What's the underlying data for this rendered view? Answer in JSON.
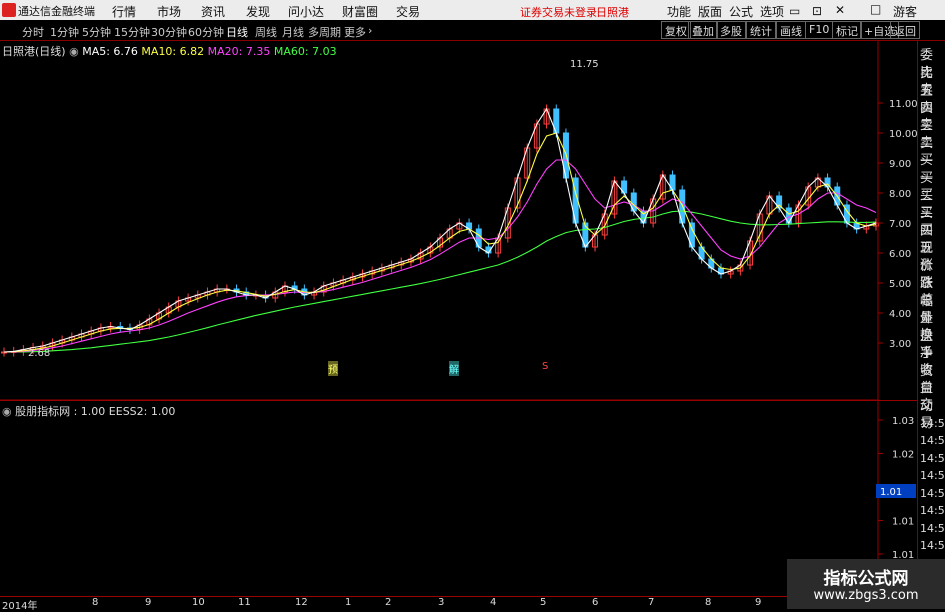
{
  "app": {
    "title": "通达信金融终端",
    "menu": [
      "行情",
      "市场",
      "资讯",
      "发现",
      "问小达",
      "财富圈",
      "交易"
    ],
    "notice": "证券交易未登录",
    "stock": "日照港",
    "right_menu": [
      "功能",
      "版面",
      "公式",
      "选项"
    ],
    "user": "游客"
  },
  "toolbar": {
    "periods": [
      "分时",
      "1分钟",
      "5分钟",
      "15分钟",
      "30分钟",
      "60分钟",
      "日线",
      "周线",
      "月线",
      "多周期",
      "更多"
    ],
    "active": "日线",
    "buttons": [
      "复权",
      "叠加",
      "多股",
      "统计",
      "画线",
      "F10",
      "标记",
      "+自选",
      "返回"
    ]
  },
  "chart": {
    "name": "日照港(日线)",
    "ma5": "MA5: 6.76",
    "ma10": "MA10: 6.82",
    "ma20": "MA20: 7.35",
    "ma60": "MA60: 7.03",
    "high_label": "11.75",
    "low_label": "2.68",
    "markers": [
      "预",
      "解",
      "S"
    ]
  },
  "indicator": {
    "label": "股朋指标网 : 1.00  EESS2: 1.00"
  },
  "right_panel": [
    "委比",
    "卖五",
    "卖四",
    "卖三",
    "卖二",
    "卖一",
    "买一",
    "买二",
    "买三",
    "买四",
    "买五",
    "现价",
    "涨跌",
    "涨幅",
    "总量",
    "外盘",
    "换手",
    "净资",
    "收益",
    "自动",
    "交易",
    "14:56",
    "14:56",
    "14:56",
    "14:56",
    "14:56",
    "14:56",
    "14:56",
    "14:56"
  ],
  "time_axis": [
    "2014年",
    "8",
    "9",
    "10",
    "11",
    "12",
    "1",
    "2",
    "3",
    "4",
    "5",
    "6",
    "7",
    "8",
    "9",
    "10"
  ],
  "brand": {
    "name": "指标公式网",
    "url": "www.zbgs3.com"
  },
  "colors": {
    "ma5": "#ffffff",
    "ma10": "#ffff40",
    "ma20": "#ff40ff",
    "ma60": "#40ff40",
    "up": "#ff4040",
    "down": "#40c0ff",
    "accent": "#ffcc00"
  },
  "chart_data": {
    "type": "line",
    "y_ticks": [
      "11.00",
      "10.00",
      "9.00",
      "8.00",
      "7.00",
      "6.00",
      "5.00",
      "4.00",
      "3.00"
    ],
    "ind_ticks": [
      "1.03",
      "1.02",
      "1.02",
      "1.01",
      "1.01",
      "1.00"
    ],
    "ind_current": "1.01",
    "close": [
      2.7,
      2.72,
      2.78,
      2.85,
      2.9,
      3.0,
      3.1,
      3.2,
      3.3,
      3.4,
      3.5,
      3.55,
      3.5,
      3.45,
      3.6,
      3.8,
      4.0,
      4.2,
      4.4,
      4.5,
      4.6,
      4.7,
      4.8,
      4.8,
      4.7,
      4.6,
      4.6,
      4.5,
      4.7,
      4.9,
      4.8,
      4.6,
      4.7,
      4.9,
      5.0,
      5.1,
      5.2,
      5.3,
      5.4,
      5.5,
      5.6,
      5.7,
      5.8,
      6.0,
      6.2,
      6.5,
      6.8,
      7.0,
      6.8,
      6.2,
      6.0,
      6.5,
      7.5,
      8.5,
      9.5,
      10.3,
      10.8,
      10.0,
      8.5,
      7.0,
      6.2,
      6.6,
      7.3,
      8.4,
      8.0,
      7.4,
      7.0,
      7.8,
      8.6,
      8.1,
      7.0,
      6.2,
      5.8,
      5.5,
      5.3,
      5.4,
      5.6,
      6.4,
      7.3,
      7.9,
      7.5,
      7.0,
      7.6,
      8.2,
      8.5,
      8.2,
      7.6,
      7.0,
      6.8,
      6.9,
      7.0
    ],
    "ma5": [
      2.7,
      2.72,
      2.78,
      2.85,
      2.9,
      3.0,
      3.1,
      3.2,
      3.3,
      3.4,
      3.5,
      3.55,
      3.5,
      3.45,
      3.6,
      3.8,
      4.0,
      4.2,
      4.4,
      4.5,
      4.6,
      4.7,
      4.8,
      4.8,
      4.7,
      4.6,
      4.6,
      4.5,
      4.7,
      4.9,
      4.8,
      4.6,
      4.7,
      4.9,
      5.0,
      5.1,
      5.2,
      5.3,
      5.4,
      5.5,
      5.6,
      5.7,
      5.8,
      6.0,
      6.2,
      6.5,
      6.8,
      7.0,
      6.8,
      6.2,
      6.0,
      6.5,
      7.5,
      8.5,
      9.5,
      10.3,
      10.8,
      10.0,
      8.5,
      7.0,
      6.2,
      6.6,
      7.3,
      8.4,
      8.0,
      7.4,
      7.0,
      7.8,
      8.6,
      8.1,
      7.0,
      6.2,
      5.8,
      5.5,
      5.3,
      5.4,
      5.6,
      6.4,
      7.3,
      7.9,
      7.5,
      7.0,
      7.6,
      8.2,
      8.5,
      8.2,
      7.6,
      7.0,
      6.8,
      6.9,
      7.0
    ],
    "ma10": [
      2.7,
      2.71,
      2.74,
      2.78,
      2.83,
      2.9,
      3.0,
      3.1,
      3.2,
      3.3,
      3.4,
      3.47,
      3.49,
      3.48,
      3.52,
      3.62,
      3.8,
      4.0,
      4.2,
      4.35,
      4.48,
      4.6,
      4.7,
      4.76,
      4.74,
      4.68,
      4.62,
      4.56,
      4.62,
      4.72,
      4.78,
      4.7,
      4.68,
      4.76,
      4.88,
      5.0,
      5.12,
      5.22,
      5.32,
      5.42,
      5.52,
      5.62,
      5.72,
      5.86,
      6.02,
      6.25,
      6.5,
      6.72,
      6.8,
      6.6,
      6.3,
      6.35,
      6.9,
      7.6,
      8.4,
      9.3,
      9.9,
      10.0,
      9.3,
      8.0,
      6.9,
      6.6,
      6.9,
      7.6,
      7.9,
      7.6,
      7.3,
      7.5,
      8.0,
      8.1,
      7.6,
      6.8,
      6.2,
      5.8,
      5.5,
      5.45,
      5.5,
      5.9,
      6.6,
      7.3,
      7.6,
      7.3,
      7.4,
      7.8,
      8.2,
      8.3,
      7.9,
      7.4,
      7.0,
      6.9,
      6.95
    ],
    "ma20": [
      2.7,
      2.7,
      2.72,
      2.75,
      2.79,
      2.84,
      2.9,
      2.98,
      3.06,
      3.14,
      3.22,
      3.3,
      3.36,
      3.4,
      3.44,
      3.5,
      3.6,
      3.72,
      3.86,
      4.0,
      4.12,
      4.24,
      4.36,
      4.46,
      4.54,
      4.58,
      4.6,
      4.6,
      4.62,
      4.66,
      4.7,
      4.68,
      4.68,
      4.72,
      4.78,
      4.86,
      4.94,
      5.02,
      5.12,
      5.22,
      5.32,
      5.42,
      5.52,
      5.64,
      5.78,
      5.96,
      6.16,
      6.36,
      6.5,
      6.5,
      6.45,
      6.5,
      6.8,
      7.2,
      7.7,
      8.3,
      8.8,
      9.1,
      9.1,
      8.8,
      8.3,
      7.8,
      7.5,
      7.6,
      7.7,
      7.6,
      7.4,
      7.4,
      7.6,
      7.8,
      7.7,
      7.3,
      6.9,
      6.5,
      6.1,
      5.9,
      5.8,
      5.9,
      6.2,
      6.6,
      7.0,
      7.2,
      7.3,
      7.5,
      7.8,
      8.0,
      8.0,
      7.8,
      7.6,
      7.5,
      7.35
    ],
    "ma60": [
      2.7,
      2.7,
      2.7,
      2.71,
      2.72,
      2.74,
      2.76,
      2.78,
      2.81,
      2.84,
      2.88,
      2.92,
      2.96,
      3.0,
      3.04,
      3.08,
      3.14,
      3.2,
      3.27,
      3.35,
      3.43,
      3.51,
      3.6,
      3.68,
      3.76,
      3.84,
      3.92,
      3.99,
      4.06,
      4.13,
      4.2,
      4.26,
      4.32,
      4.38,
      4.44,
      4.5,
      4.56,
      4.62,
      4.68,
      4.74,
      4.8,
      4.86,
      4.92,
      4.98,
      5.05,
      5.12,
      5.2,
      5.28,
      5.36,
      5.44,
      5.52,
      5.6,
      5.72,
      5.86,
      6.02,
      6.2,
      6.4,
      6.55,
      6.68,
      6.75,
      6.78,
      6.8,
      6.85,
      6.95,
      7.05,
      7.12,
      7.16,
      7.2,
      7.3,
      7.38,
      7.4,
      7.36,
      7.3,
      7.22,
      7.14,
      7.06,
      7.0,
      6.96,
      6.94,
      6.94,
      6.95,
      6.96,
      6.98,
      7.0,
      7.02,
      7.04,
      7.04,
      7.03,
      7.02,
      7.02,
      7.03
    ]
  }
}
